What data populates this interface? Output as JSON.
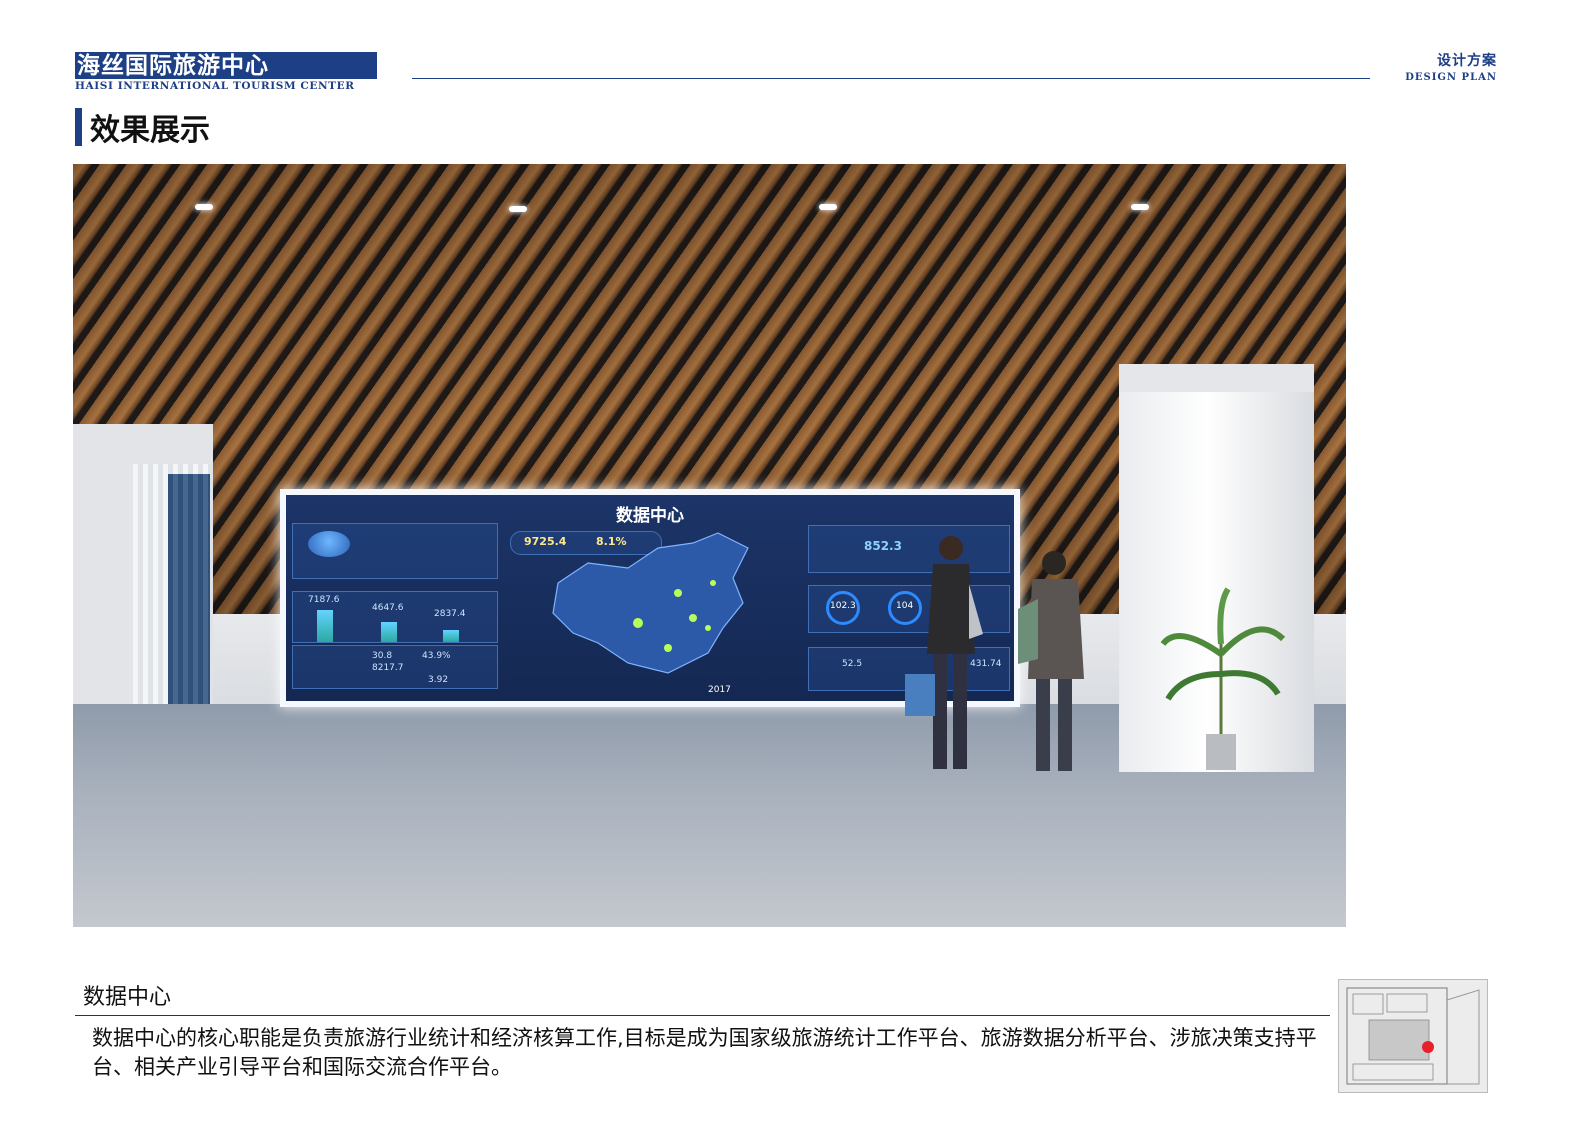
{
  "header": {
    "brand_cn": "海丝国际旅游中心",
    "brand_en": "HAISI INTERNATIONAL TOURISM CENTER",
    "plan_cn": "设计方案",
    "plan_en": "DESIGN PLAN"
  },
  "section": {
    "title": "效果展示"
  },
  "rendering": {
    "screen_title": "数据中心",
    "kpi_main": "9725.4",
    "kpi_main_pct": "8.1%",
    "kpi_right": "852.3",
    "ring_1": "102.3",
    "ring_2": "104",
    "val_a": "7187.6",
    "val_b": "4647.6",
    "val_c": "2837.4",
    "val_d": "52.5",
    "val_e": "431.74",
    "val_f": "30.8",
    "val_g": "43.9%",
    "val_h": "8217.7",
    "val_i": "3.92",
    "val_j": "2017"
  },
  "caption": {
    "title": "数据中心",
    "body": "数据中心的核心职能是负责旅游行业统计和经济核算工作,目标是成为国家级旅游统计工作平台、旅游数据分析平台、涉旅决策支持平台、相关产业引导平台和国际交流合作平台。"
  },
  "colors": {
    "brand": "#1d3f86",
    "marker": "#e8202a"
  }
}
